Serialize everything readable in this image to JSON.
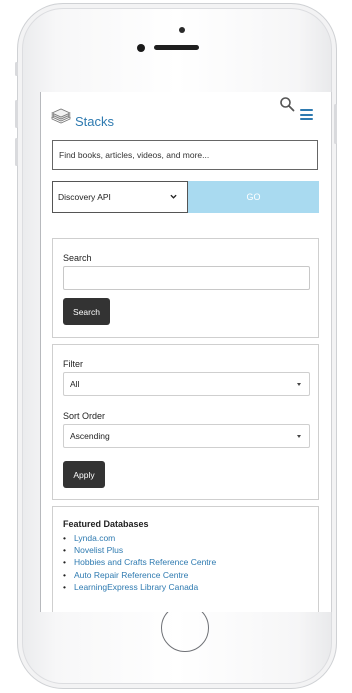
{
  "header": {
    "brand": "Stacks",
    "icons": [
      "stack-logo-icon",
      "search-icon",
      "hamburger-menu-icon"
    ]
  },
  "search_bar": {
    "placeholder": "Find books, articles, videos, and more...",
    "source_selected": "Discovery API",
    "go_label": "GO"
  },
  "search_panel": {
    "label": "Search",
    "input_value": "",
    "button_label": "Search"
  },
  "filter_panel": {
    "filter_label": "Filter",
    "filter_value": "All",
    "sort_label": "Sort Order",
    "sort_value": "Ascending",
    "apply_label": "Apply"
  },
  "featured": {
    "title": "Featured Databases",
    "items": [
      "Lynda.com",
      "Novelist Plus",
      "Hobbies and Crafts Reference Centre",
      "Auto Repair Reference Centre",
      "LearningExpress Library Canada"
    ]
  },
  "colors": {
    "brand_blue": "#2e7ab0",
    "go_button": "#a9daf0",
    "dark_button": "#333333"
  }
}
